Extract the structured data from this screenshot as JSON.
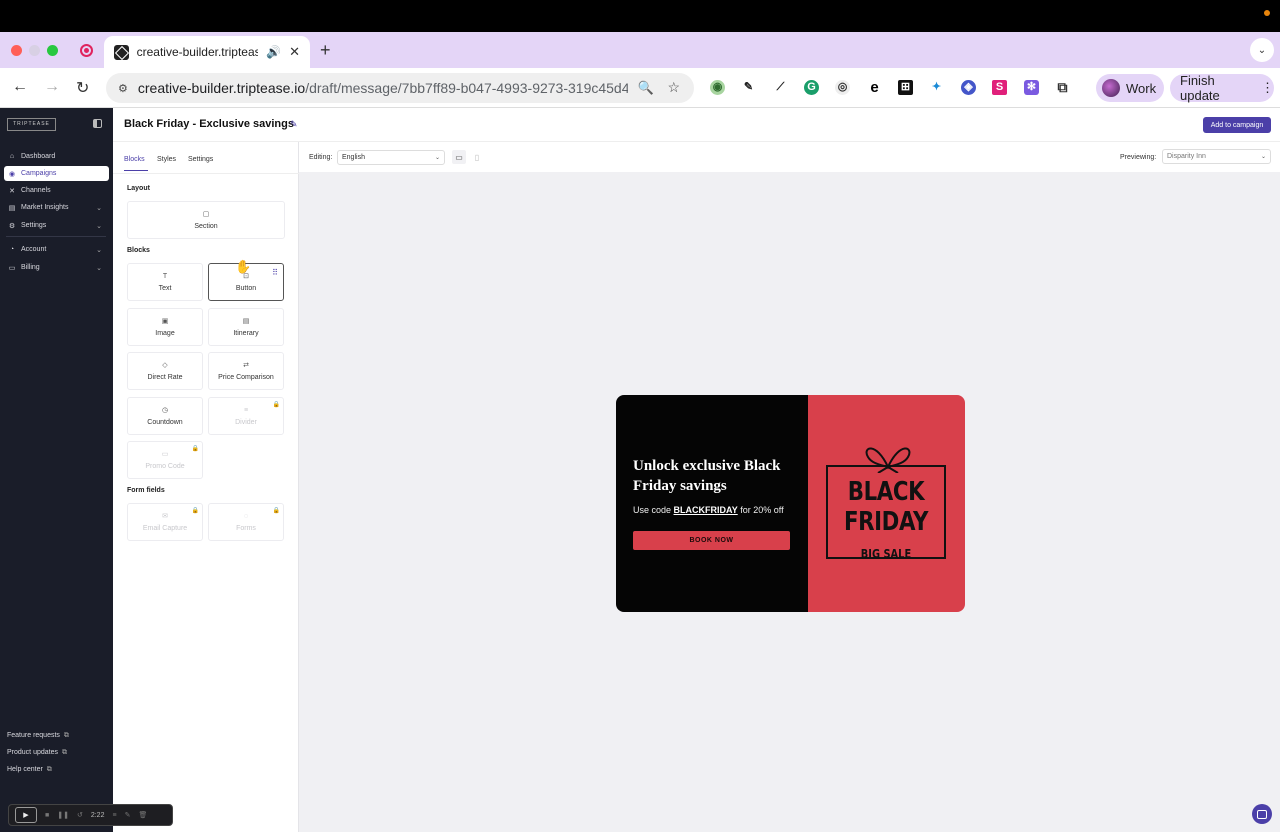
{
  "browser": {
    "tab_title": "creative-builder.triptease.io",
    "url_host": "creative-builder.triptease.io",
    "url_path": "/draft/message/7bb7ff89-b047-4993-9273-319c45d4...",
    "profile_label": "Work",
    "update_label": "Finish update"
  },
  "sidebar": {
    "logo": "TRIPTEASE",
    "items": [
      {
        "label": "Dashboard",
        "icon": "home-icon",
        "active": false,
        "expandable": false
      },
      {
        "label": "Campaigns",
        "icon": "megaphone-icon",
        "active": true,
        "expandable": false
      },
      {
        "label": "Channels",
        "icon": "channels-icon",
        "active": false,
        "expandable": false
      },
      {
        "label": "Market Insights",
        "icon": "chart-icon",
        "active": false,
        "expandable": true
      },
      {
        "label": "Settings",
        "icon": "gear-icon",
        "active": false,
        "expandable": true
      },
      {
        "label": "Account",
        "icon": "user-icon",
        "active": false,
        "expandable": true
      },
      {
        "label": "Billing",
        "icon": "card-icon",
        "active": false,
        "expandable": true
      }
    ],
    "footer_links": [
      "Feature requests",
      "Product updates",
      "Help center"
    ]
  },
  "editor": {
    "title": "Black Friday - Exclusive savings",
    "add_button": "Add to campaign",
    "editing_label": "Editing:",
    "editing_value": "English",
    "previewing_label": "Previewing:",
    "previewing_value": "Disparity Inn"
  },
  "panel": {
    "tabs": [
      "Blocks",
      "Styles",
      "Settings"
    ],
    "active_tab": "Blocks",
    "groups": {
      "layout": "Layout",
      "blocks": "Blocks",
      "form_fields": "Form fields"
    },
    "layout_blocks": [
      {
        "label": "Section",
        "icon": "square-icon"
      }
    ],
    "blocks": [
      {
        "label": "Text",
        "icon": "text-icon",
        "locked": false
      },
      {
        "label": "Button",
        "icon": "button-icon",
        "locked": false
      },
      {
        "label": "Image",
        "icon": "image-icon",
        "locked": false
      },
      {
        "label": "Itinerary",
        "icon": "calendar-icon",
        "locked": false
      },
      {
        "label": "Direct Rate",
        "icon": "tag-icon",
        "locked": false
      },
      {
        "label": "Price Comparison",
        "icon": "compare-icon",
        "locked": false
      },
      {
        "label": "Countdown",
        "icon": "timer-icon",
        "locked": false
      },
      {
        "label": "Divider",
        "icon": "divider-icon",
        "locked": true
      },
      {
        "label": "Promo Code",
        "icon": "ticket-icon",
        "locked": true
      }
    ],
    "form_blocks": [
      {
        "label": "Email Capture",
        "icon": "mail-icon",
        "locked": true
      },
      {
        "label": "Forms",
        "icon": "form-icon",
        "locked": true
      }
    ]
  },
  "preview": {
    "headline": "Unlock exclusive Black Friday savings",
    "body_prefix": "Use code ",
    "code": "BLACKFRIDAY",
    "body_suffix": " for 20% off",
    "cta": "BOOK NOW",
    "graphic_line1": "BLACK",
    "graphic_line2": "FRIDAY",
    "graphic_sub": "BIG SALE",
    "left_color": "#050505",
    "right_color": "#d8404b"
  },
  "recorder": {
    "time": "2:22"
  },
  "colors": {
    "accent": "#4b3fa8",
    "sidebar_bg": "#1a1d29",
    "tabstrip": "#e4d5f7"
  }
}
